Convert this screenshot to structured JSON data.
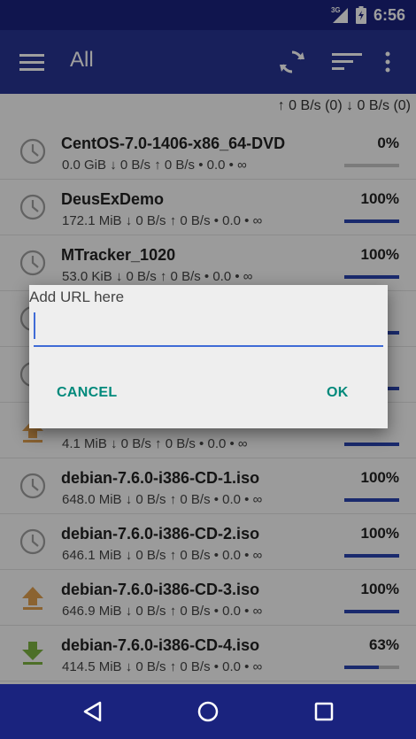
{
  "status_bar": {
    "network": "3G",
    "time": "6:56"
  },
  "app_bar": {
    "title": "All"
  },
  "speed_summary": "↑ 0 B/s (0) ↓ 0 B/s (0)",
  "torrents": [
    {
      "name": "CentOS-7.0-1406-x86_64-DVD",
      "meta": "0.0 GiB ↓ 0 B/s ↑ 0 B/s • 0.0 • ∞",
      "percent": "0%",
      "progress": 0,
      "icon": "clock-icon"
    },
    {
      "name": "DeusExDemo",
      "meta": "172.1 MiB ↓ 0 B/s ↑ 0 B/s • 0.0 • ∞",
      "percent": "100%",
      "progress": 1,
      "icon": "clock-icon"
    },
    {
      "name": "MTracker_1020",
      "meta": "53.0 KiB ↓ 0 B/s ↑ 0 B/s • 0.0 • ∞",
      "percent": "100%",
      "progress": 1,
      "icon": "clock-icon"
    },
    {
      "name": "",
      "meta": "",
      "percent": "",
      "progress": 1,
      "icon": "clock-icon"
    },
    {
      "name": "",
      "meta": "",
      "percent": "",
      "progress": 1,
      "icon": "clock-icon"
    },
    {
      "name": "",
      "meta": "4.1 MiB ↓ 0 B/s ↑ 0 B/s • 0.0 • ∞",
      "percent": "",
      "progress": 1,
      "icon": "upload-icon"
    },
    {
      "name": "debian-7.6.0-i386-CD-1.iso",
      "meta": "648.0 MiB ↓ 0 B/s ↑ 0 B/s • 0.0 • ∞",
      "percent": "100%",
      "progress": 1,
      "icon": "clock-icon"
    },
    {
      "name": "debian-7.6.0-i386-CD-2.iso",
      "meta": "646.1 MiB ↓ 0 B/s ↑ 0 B/s • 0.0 • ∞",
      "percent": "100%",
      "progress": 1,
      "icon": "clock-icon"
    },
    {
      "name": "debian-7.6.0-i386-CD-3.iso",
      "meta": "646.9 MiB ↓ 0 B/s ↑ 0 B/s • 0.0 • ∞",
      "percent": "100%",
      "progress": 1,
      "icon": "upload-icon"
    },
    {
      "name": "debian-7.6.0-i386-CD-4.iso",
      "meta": "414.5 MiB ↓ 0 B/s ↑ 0 B/s • 0.0 • ∞",
      "percent": "63%",
      "progress": 0.63,
      "icon": "download-icon"
    }
  ],
  "dialog": {
    "title": "Add URL here",
    "input_value": "",
    "cancel_label": "CANCEL",
    "ok_label": "OK"
  },
  "colors": {
    "status_bar": "#1a237e",
    "app_bar": "#283593",
    "progress": "#2a45b0",
    "dialog_button": "#00897b",
    "upload_icon": "#e0a050",
    "download_icon": "#7cb342"
  }
}
